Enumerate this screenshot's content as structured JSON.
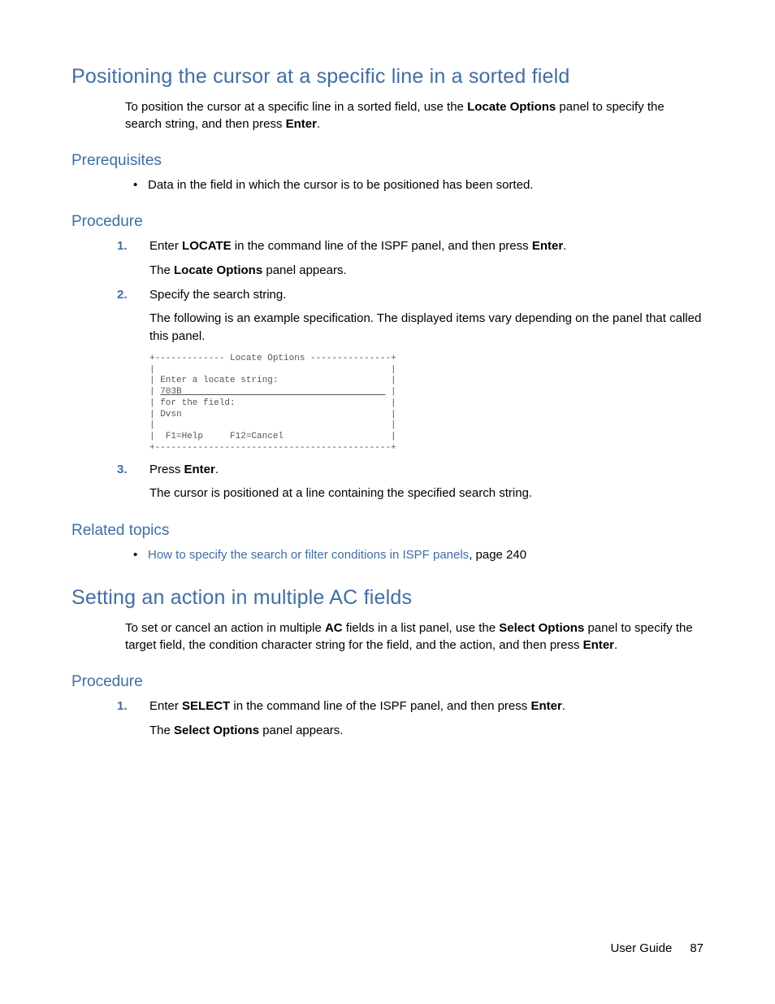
{
  "section1": {
    "title": "Positioning the cursor at a specific line in a sorted field",
    "intro_pre": "To position the cursor at a specific line in a sorted field, use the ",
    "intro_bold": "Locate Options",
    "intro_mid": " panel to specify the search string, and then press ",
    "intro_bold2": "Enter",
    "intro_end": ".",
    "prereq_heading": "Prerequisites",
    "prereq_item": "Data in the field in which the cursor is to be positioned has been sorted.",
    "proc_heading": "Procedure",
    "step1_num": "1.",
    "step1_pre": "Enter ",
    "step1_locate": "LOCATE",
    "step1_mid": " in the command line of the ISPF panel, and then press ",
    "step1_enter": "Enter",
    "step1_end": ".",
    "step1_res_pre": "The ",
    "step1_res_bold": "Locate Options",
    "step1_res_end": " panel appears.",
    "step2_num": "2.",
    "step2_text": "Specify the search string.",
    "step2_expl": "The following is an example specification. The displayed items vary depending on the panel that called this panel.",
    "code_top": "+------------- Locate Options ---------------+",
    "code_l1": "|                                            |",
    "code_l2": "| Enter a locate string:                     |",
    "code_l3a": "| ",
    "code_l3b": "703B                                      ",
    "code_l3c": " |",
    "code_l4": "| for the field:                             |",
    "code_l5": "| Dvsn                                       |",
    "code_l6": "|                                            |",
    "code_l7": "|  F1=Help     F12=Cancel                    |",
    "code_bot": "+--------------------------------------------+",
    "step3_num": "3.",
    "step3_pre": "Press ",
    "step3_enter": "Enter",
    "step3_end": ".",
    "step3_res": "The cursor is positioned at a line containing the specified search string.",
    "related_heading": "Related topics",
    "related_link": "How to specify the search or filter conditions in ISPF panels",
    "related_suffix": ", page 240"
  },
  "section2": {
    "title": "Setting an action in multiple AC fields",
    "intro_p1": "To set or cancel an action in multiple ",
    "intro_ac": "AC",
    "intro_p2": " fields in a list panel, use the ",
    "intro_sel": "Select Options",
    "intro_p3": " panel to specify the target field, the condition character string for the field, and the action, and then press ",
    "intro_enter": "Enter",
    "intro_p4": ".",
    "proc_heading": "Procedure",
    "step1_num": "1.",
    "step1_pre": "Enter ",
    "step1_select": "SELECT",
    "step1_mid": " in the command line of the ISPF panel, and then press ",
    "step1_enter": "Enter",
    "step1_end": ".",
    "step1_res_pre": "The ",
    "step1_res_bold": "Select Options",
    "step1_res_end": " panel appears."
  },
  "footer": {
    "label": "User Guide",
    "page": "87"
  }
}
